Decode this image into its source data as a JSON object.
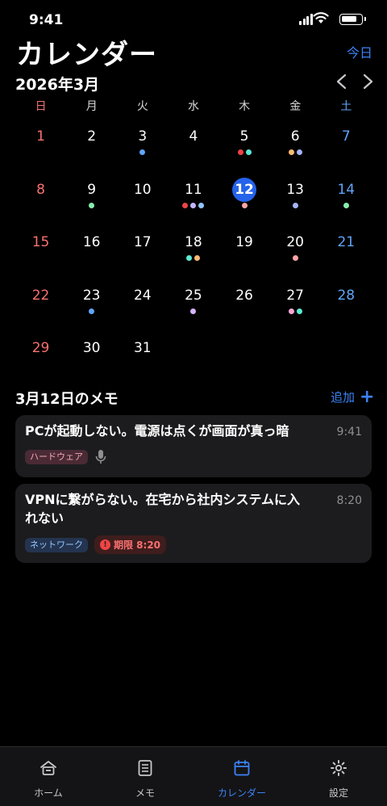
{
  "status_bar": {
    "time": "9:41"
  },
  "header": {
    "title": "カレンダー",
    "today_label": "今日"
  },
  "calendar": {
    "month_label": "2026年3月",
    "weekdays": [
      "日",
      "月",
      "火",
      "水",
      "木",
      "金",
      "土"
    ],
    "selected_day": 12,
    "weeks": [
      [
        {
          "day": "1",
          "dots": []
        },
        {
          "day": "2",
          "dots": []
        },
        {
          "day": "3",
          "dots": [
            "#60a5fa"
          ]
        },
        {
          "day": "4",
          "dots": []
        },
        {
          "day": "5",
          "dots": [
            "#ef4444",
            "#5eead4"
          ]
        },
        {
          "day": "6",
          "dots": [
            "#fdba74",
            "#a5b4fc"
          ]
        },
        {
          "day": "7",
          "dots": []
        }
      ],
      [
        {
          "day": "8",
          "dots": []
        },
        {
          "day": "9",
          "dots": [
            "#86efac"
          ]
        },
        {
          "day": "10",
          "dots": []
        },
        {
          "day": "11",
          "dots": [
            "#ef4444",
            "#c4b5fd",
            "#93c5fd"
          ]
        },
        {
          "day": "12",
          "dots": [
            "#fca5a5"
          ]
        },
        {
          "day": "13",
          "dots": [
            "#a5b4fc"
          ]
        },
        {
          "day": "14",
          "dots": [
            "#86efac"
          ]
        }
      ],
      [
        {
          "day": "15",
          "dots": []
        },
        {
          "day": "16",
          "dots": []
        },
        {
          "day": "17",
          "dots": []
        },
        {
          "day": "18",
          "dots": [
            "#5eead4",
            "#fdba74"
          ]
        },
        {
          "day": "19",
          "dots": []
        },
        {
          "day": "20",
          "dots": [
            "#fca5a5"
          ]
        },
        {
          "day": "21",
          "dots": []
        }
      ],
      [
        {
          "day": "22",
          "dots": []
        },
        {
          "day": "23",
          "dots": [
            "#60a5fa"
          ]
        },
        {
          "day": "24",
          "dots": []
        },
        {
          "day": "25",
          "dots": [
            "#d8b4fe"
          ]
        },
        {
          "day": "26",
          "dots": []
        },
        {
          "day": "27",
          "dots": [
            "#f9a8d4",
            "#5eead4"
          ]
        },
        {
          "day": "28",
          "dots": []
        }
      ],
      [
        {
          "day": "29",
          "dots": []
        },
        {
          "day": "30",
          "dots": []
        },
        {
          "day": "31",
          "dots": []
        },
        {
          "day": "",
          "dots": []
        },
        {
          "day": "",
          "dots": []
        },
        {
          "day": "",
          "dots": []
        },
        {
          "day": "",
          "dots": []
        }
      ]
    ]
  },
  "memos": {
    "header": "3月12日のメモ",
    "add_label": "追加",
    "items": [
      {
        "title": "PCが起動しない。電源は点くが画面が真っ暗",
        "time": "9:41",
        "tag": "ハードウェア",
        "has_voice": true
      },
      {
        "title": "VPNに繋がらない。在宅から社内システムに入れない",
        "time": "8:20",
        "tag": "ネットワーク",
        "deadline": "期限 8:20"
      }
    ]
  },
  "tabbar": {
    "items": [
      {
        "label": "ホーム",
        "icon": "home-icon"
      },
      {
        "label": "メモ",
        "icon": "memo-icon"
      },
      {
        "label": "カレンダー",
        "icon": "calendar-icon",
        "active": true
      },
      {
        "label": "設定",
        "icon": "gear-icon"
      }
    ]
  },
  "colors": {
    "accent": "#3b82f6",
    "selected": "#2563eb",
    "sunday": "#f87171",
    "saturday": "#60a5fa",
    "card_bg": "#1c1c1e"
  }
}
